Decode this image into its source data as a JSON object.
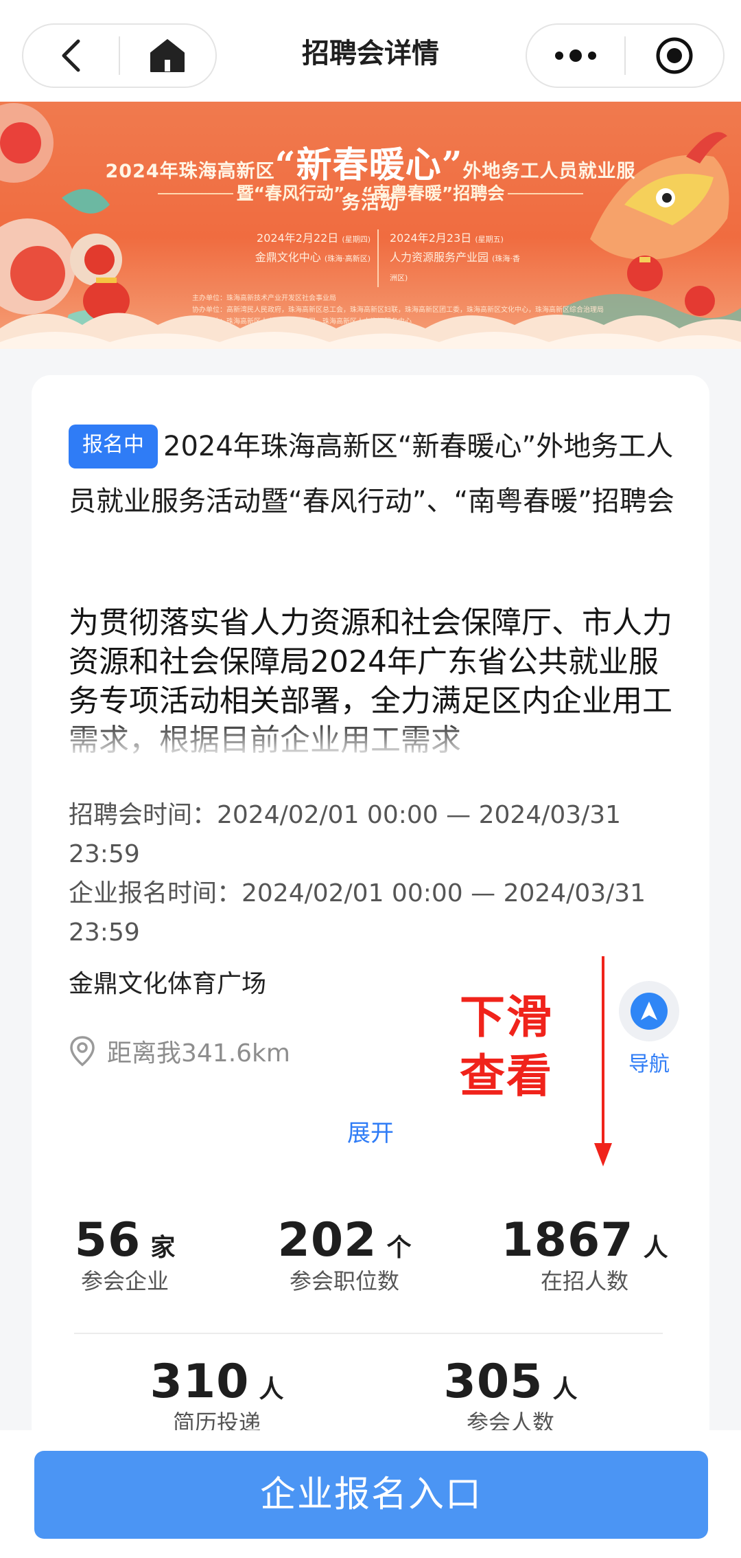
{
  "header": {
    "title": "招聘会详情",
    "back_icon": "chevron-left-icon",
    "home_icon": "home-icon",
    "more_icon": "more-dots-icon",
    "close_icon": "target-icon"
  },
  "banner": {
    "headline_pre": "2024年珠海高新区",
    "headline_big": "“新春暖心”",
    "headline_post": "外地务工人员就业服务活动",
    "subline": "暨“春风行动”、“南粤春暖”招聘会",
    "date_left": "2024年2月22日",
    "date_left_note": "(星期四)",
    "place_left": "金鼎文化中心",
    "place_left_note": "(珠海·高新区)",
    "date_right": "2024年2月23日",
    "date_right_note": "(星期五)",
    "place_right": "人力资源服务产业园",
    "place_right_note": "(珠海·香洲区)",
    "org_lines": [
      "主办单位：珠海高新技术产业开发区社会事业局",
      "协办单位：高新湾民人民政府，珠海高新区总工会，珠海高新区妇联，珠海高新区团工委，珠海高新区文化中心，珠海高新区综合治理局",
      "承办单位：珠海高新区人力资源有限公司，珠海高新区人力资源服务中心"
    ]
  },
  "event": {
    "status_badge": "报名中",
    "title": "2024年珠海高新区“新春暖心”外地务工人员就业服务活动暨“春风行动”、“南粤春暖”招聘会",
    "intro": "为贯彻落实省人力资源和社会保障厅、市人力资源和社会保障局2024年广东省公共就业服务专项活动相关部署，全力满足区内企业用工需求，根据目前企业用工需求",
    "fair_time": "招聘会时间：2024/02/01 00:00 — 2024/03/31 23:59",
    "signup_time": "企业报名时间：2024/02/01 00:00 — 2024/03/31 23:59",
    "venue": "金鼎文化体育广场",
    "distance": "距离我341.6km",
    "nav_label": "导航",
    "expand_label": "展开"
  },
  "annotation": {
    "line1": "下滑",
    "line2": "查看",
    "color": "#f0231b"
  },
  "stats": [
    {
      "value": "56",
      "unit": "家",
      "label": "参会企业"
    },
    {
      "value": "202",
      "unit": "个",
      "label": "参会职位数"
    },
    {
      "value": "1867",
      "unit": "人",
      "label": "在招人数"
    },
    {
      "value": "310",
      "unit": "人",
      "label": "简历投递"
    },
    {
      "value": "305",
      "unit": "人",
      "label": "参会人数"
    }
  ],
  "cta": {
    "label": "企业报名入口",
    "color": "#4b95f4"
  },
  "colors": {
    "accent": "#2f7cf6",
    "banner": "#f06c40"
  }
}
